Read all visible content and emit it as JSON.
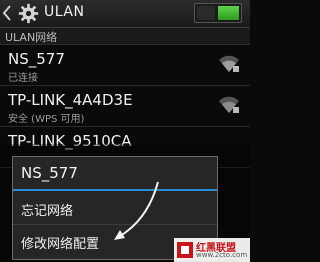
{
  "header": {
    "title": "ULAN",
    "wifi_enabled": true,
    "accent_color": "#3fb52c"
  },
  "section": {
    "label": "ULAN网络"
  },
  "networks": [
    {
      "name": "NS_577",
      "status": "已连接"
    },
    {
      "name": "TP-LINK_4A4D3E",
      "status": "安全 (WPS 可用)"
    },
    {
      "name": "TP-LINK_9510CA",
      "status": ""
    }
  ],
  "dialog": {
    "title": "NS_577",
    "options": [
      "忘记网络",
      "修改网络配置"
    ],
    "accent_color": "#2c8cd7"
  },
  "watermark": {
    "brand": "红黑联盟",
    "site": "www.2cto.com"
  }
}
